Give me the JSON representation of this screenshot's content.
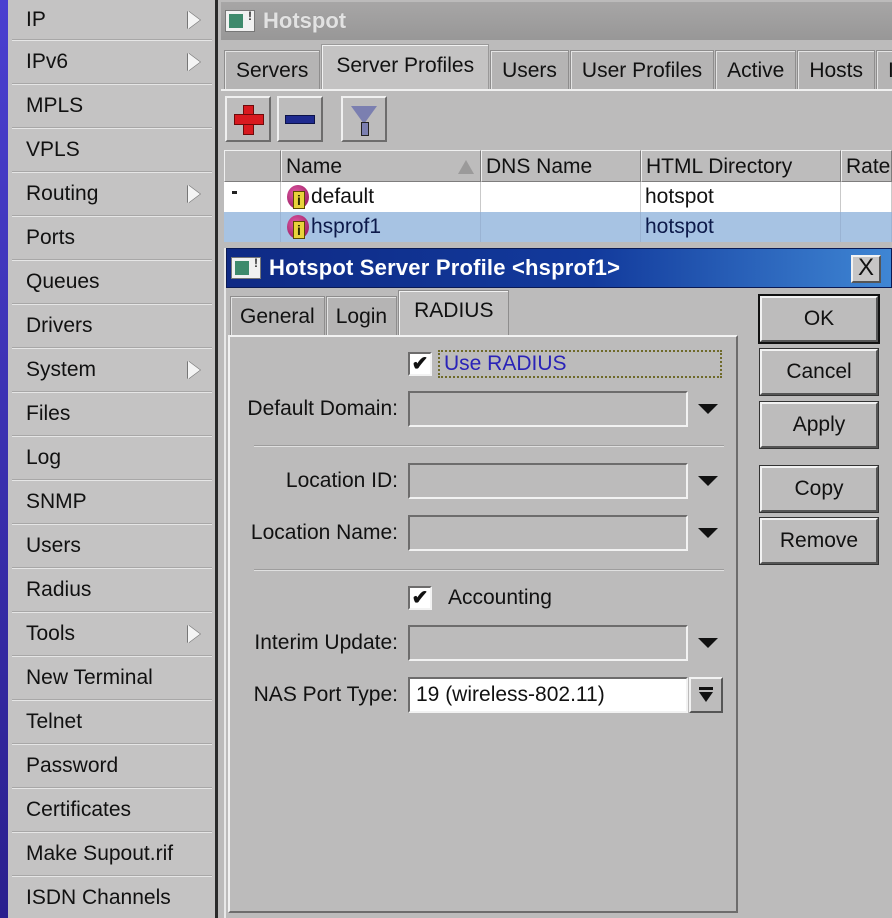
{
  "sidebar": {
    "items": [
      {
        "label": "IP",
        "submenu": true
      },
      {
        "label": "IPv6",
        "submenu": true
      },
      {
        "label": "MPLS",
        "submenu": false
      },
      {
        "label": "VPLS",
        "submenu": false
      },
      {
        "label": "Routing",
        "submenu": true
      },
      {
        "label": "Ports",
        "submenu": false
      },
      {
        "label": "Queues",
        "submenu": false
      },
      {
        "label": "Drivers",
        "submenu": false
      },
      {
        "label": "System",
        "submenu": true
      },
      {
        "label": "Files",
        "submenu": false
      },
      {
        "label": "Log",
        "submenu": false
      },
      {
        "label": "SNMP",
        "submenu": false
      },
      {
        "label": "Users",
        "submenu": false
      },
      {
        "label": "Radius",
        "submenu": false
      },
      {
        "label": "Tools",
        "submenu": true
      },
      {
        "label": "New Terminal",
        "submenu": false
      },
      {
        "label": "Telnet",
        "submenu": false
      },
      {
        "label": "Password",
        "submenu": false
      },
      {
        "label": "Certificates",
        "submenu": false
      },
      {
        "label": "Make Supout.rif",
        "submenu": false
      },
      {
        "label": "ISDN Channels",
        "submenu": false
      }
    ]
  },
  "hotspot": {
    "title": "Hotspot",
    "tabs": [
      "Servers",
      "Server Profiles",
      "Users",
      "User Profiles",
      "Active",
      "Hosts",
      "IP"
    ],
    "active_tab": "Server Profiles",
    "toolbar": {
      "add": "add-icon",
      "remove": "remove-icon",
      "filter": "filter-icon"
    },
    "table": {
      "columns": [
        "",
        "Name",
        "DNS Name",
        "HTML Directory",
        "Rate"
      ],
      "rows": [
        {
          "flag": "*",
          "name": "default",
          "dns_name": "",
          "html_directory": "hotspot",
          "rate": "",
          "selected": false
        },
        {
          "flag": "",
          "name": "hsprof1",
          "dns_name": "",
          "html_directory": "hotspot",
          "rate": "",
          "selected": true
        }
      ]
    }
  },
  "dialog": {
    "title": "Hotspot Server Profile <hsprof1>",
    "close_label": "X",
    "tabs": [
      "General",
      "Login",
      "RADIUS"
    ],
    "active_tab": "RADIUS",
    "use_radius": {
      "label": "Use RADIUS",
      "checked": true,
      "check_glyph": "✔"
    },
    "default_domain": {
      "label": "Default Domain:",
      "value": ""
    },
    "location_id": {
      "label": "Location ID:",
      "value": ""
    },
    "location_name": {
      "label": "Location Name:",
      "value": ""
    },
    "accounting": {
      "label": "Accounting",
      "checked": true,
      "check_glyph": "✔"
    },
    "interim_update": {
      "label": "Interim Update:",
      "value": ""
    },
    "nas_port_type": {
      "label": "NAS Port Type:",
      "value": "19 (wireless-802.11)"
    },
    "buttons": {
      "ok": "OK",
      "cancel": "Cancel",
      "apply": "Apply",
      "copy": "Copy",
      "remove": "Remove"
    }
  }
}
